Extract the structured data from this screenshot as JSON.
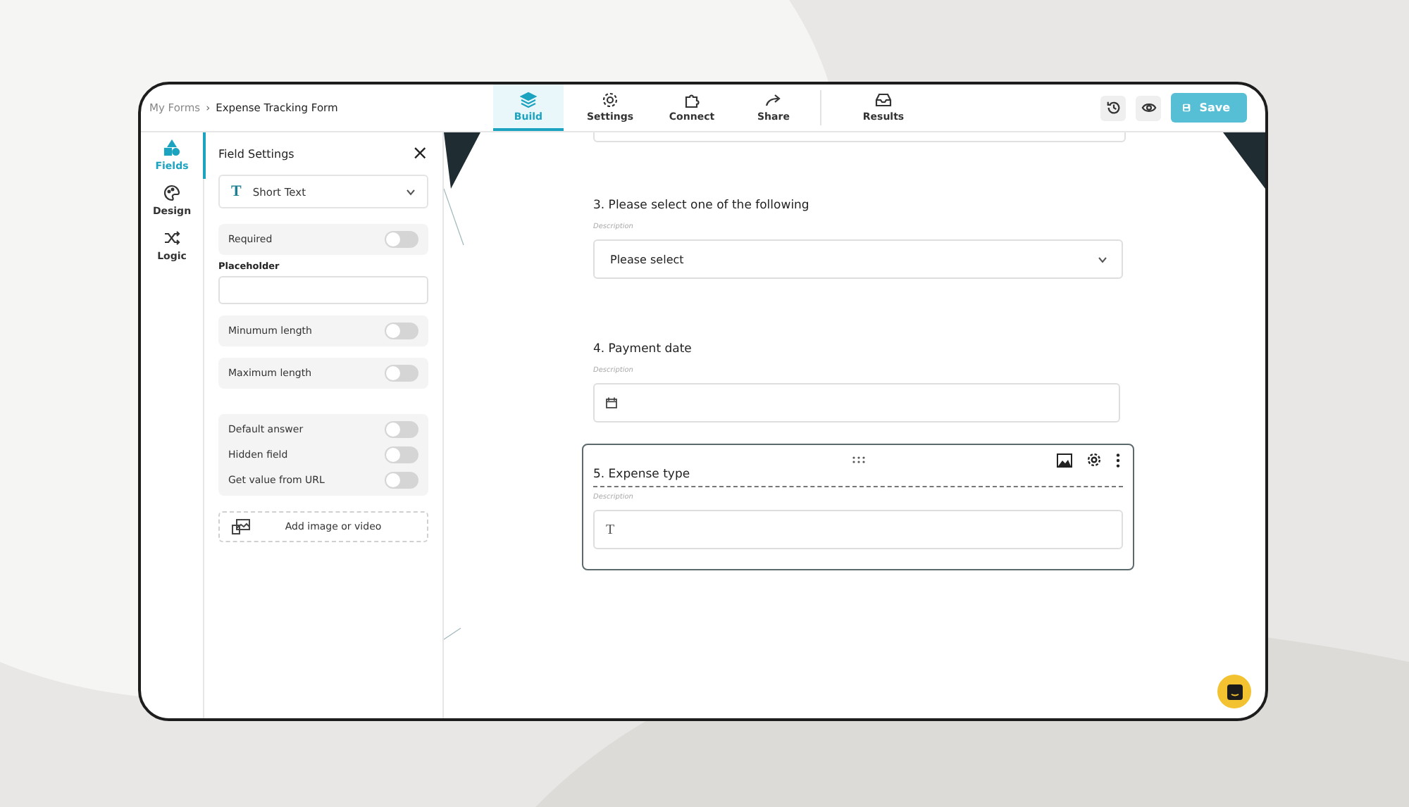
{
  "breadcrumb": {
    "root": "My Forms",
    "separator": "›",
    "current": "Expense Tracking Form"
  },
  "tabs": [
    {
      "label": "Build",
      "selected": true
    },
    {
      "label": "Settings",
      "selected": false
    },
    {
      "label": "Connect",
      "selected": false
    },
    {
      "label": "Share",
      "selected": false
    },
    {
      "label": "Results",
      "selected": false
    }
  ],
  "save_button": "Save",
  "sidebar": {
    "items": [
      {
        "label": "Fields",
        "selected": true
      },
      {
        "label": "Design",
        "selected": false
      },
      {
        "label": "Logic",
        "selected": false
      }
    ]
  },
  "field_settings": {
    "title": "Field Settings",
    "close": "×",
    "field_type": "Short Text",
    "type_glyph": "T",
    "options": [
      {
        "kind": "toggle",
        "label": "Required",
        "on": false
      },
      {
        "kind": "input",
        "label": "Placeholder"
      },
      {
        "kind": "toggle",
        "label": "Minumum length",
        "on": false
      },
      {
        "kind": "toggle",
        "label": "Maximum length",
        "on": false
      },
      {
        "kind": "group",
        "items": [
          {
            "label": "Default answer",
            "on": false
          },
          {
            "label": "Hidden field",
            "on": false
          },
          {
            "label": "Get value from URL",
            "on": false
          }
        ]
      }
    ],
    "media_button": "Add image or video"
  },
  "questions": [
    {
      "kind": "select",
      "title": "3. Please select one of the following",
      "description": "Description",
      "placeholder": "Please select",
      "selected": false
    },
    {
      "kind": "date",
      "title": "4. Payment date",
      "description": "Description",
      "selected": false
    },
    {
      "kind": "text",
      "title": "5. Expense type",
      "description": "Description",
      "glyph": "T",
      "selected": true
    }
  ]
}
